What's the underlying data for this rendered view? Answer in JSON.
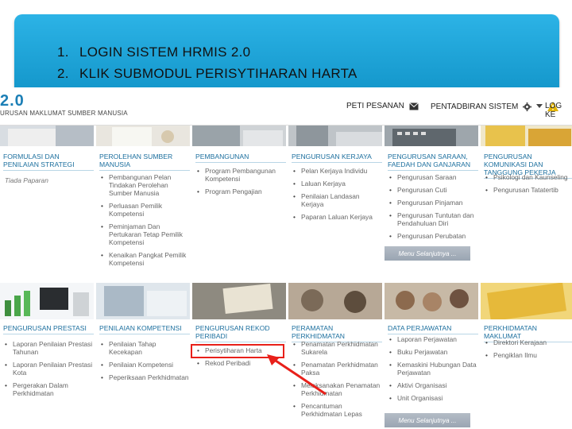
{
  "banner": {
    "items": [
      {
        "num": "1.",
        "text": "LOGIN SISTEM HRMIS 2.0"
      },
      {
        "num": "2.",
        "text": "KLIK SUBMODUL PERISYTIHARAN HARTA"
      }
    ]
  },
  "topbar": {
    "logo": "2.0",
    "subtitle": "URUSAN MAKLUMAT SUMBER MANUSIA",
    "inbox": "PETI PESANAN",
    "admin": "PENTADBIRAN SISTEM",
    "logout": "LOG KE"
  },
  "top_row": [
    {
      "title": "FORMULASI DAN PENILAIAN STRATEGI",
      "note": "Tiada Paparan",
      "items": []
    },
    {
      "title": "PEROLEHAN SUMBER MANUSIA",
      "items": [
        "Pembangunan Pelan Tindakan Perolehan Sumber Manusia",
        "Perluasan Pemilik Kompetensi",
        "Peminjaman Dan Pertukaran Tetap Pemilik Kompetensi",
        "Kenaikan Pangkat Pemilik Kompetensi"
      ]
    },
    {
      "title": "PEMBANGUNAN",
      "items": [
        "Program Pembangunan Kompetensi",
        "Program Pengajian"
      ]
    },
    {
      "title": "PENGURUSAN KERJAYA",
      "items": [
        "Pelan Kerjaya Individu",
        "Laluan Kerjaya",
        "Penilaian Landasan Kerjaya",
        "Paparan Laluan Kerjaya"
      ]
    },
    {
      "title": "PENGURUSAN SARAAN, FAEDAH DAN GANJARAN",
      "items": [
        "Pengurusan Saraan",
        "Pengurusan Cuti",
        "Pengurusan Pinjaman",
        "Pengurusan Tuntutan dan Pendahuluan Diri",
        "Pengurusan Perubatan"
      ],
      "more": "Menu Selanjutnya ..."
    },
    {
      "title": "PENGURUSAN KOMUNIKASI DAN TANGGUNG PEKERJA",
      "items": [
        "Psikologi dan Kaunseling",
        "Pengurusan Tatatertib"
      ]
    }
  ],
  "bottom_row": [
    {
      "title": "PENGURUSAN PRESTASI",
      "items": [
        "Laporan Penilaian Prestasi Tahunan",
        "Laporan Penilaian Prestasi Kota",
        "Pergerakan Dalam Perkhidmatan"
      ]
    },
    {
      "title": "PENILAIAN KOMPETENSI",
      "items": [
        "Penilaian Tahap Kecekapan",
        "Penilaian Kompetensi",
        "Peperiksaan Perkhidmatan"
      ]
    },
    {
      "title": "PENGURUSAN REKOD PERIBADI",
      "items": [
        "Perisytiharan Harta",
        "Rekod Peribadi"
      ]
    },
    {
      "title": "PERAMATAN PERKHIDMATAN",
      "items": [
        "Penamatan Perkhidmatan Sukarela",
        "Penamatan Perkhidmatan Paksa",
        "Melaksanakan Penamatan Perkhidmatan",
        "Pencantuman Perkhidmatan Lepas"
      ],
      "more": "Menu Selanjutnya ..."
    },
    {
      "title": "DATA PERJAWATAN",
      "items": [
        "Laporan Perjawatan",
        "Buku Perjawatan",
        "Kemaskini Hubungan Data Perjawatan",
        "Aktivi Organisasi",
        "Unit Organisasi"
      ]
    },
    {
      "title": "PERKHIDMATAN MAKLUMAT",
      "items": [
        "Direktori Kerajaan",
        "Pengiklan Ilmu"
      ]
    }
  ],
  "colors": {
    "banner": "#1aa6d9",
    "title": "#1c6f9e",
    "highlight": "#e8201a"
  }
}
